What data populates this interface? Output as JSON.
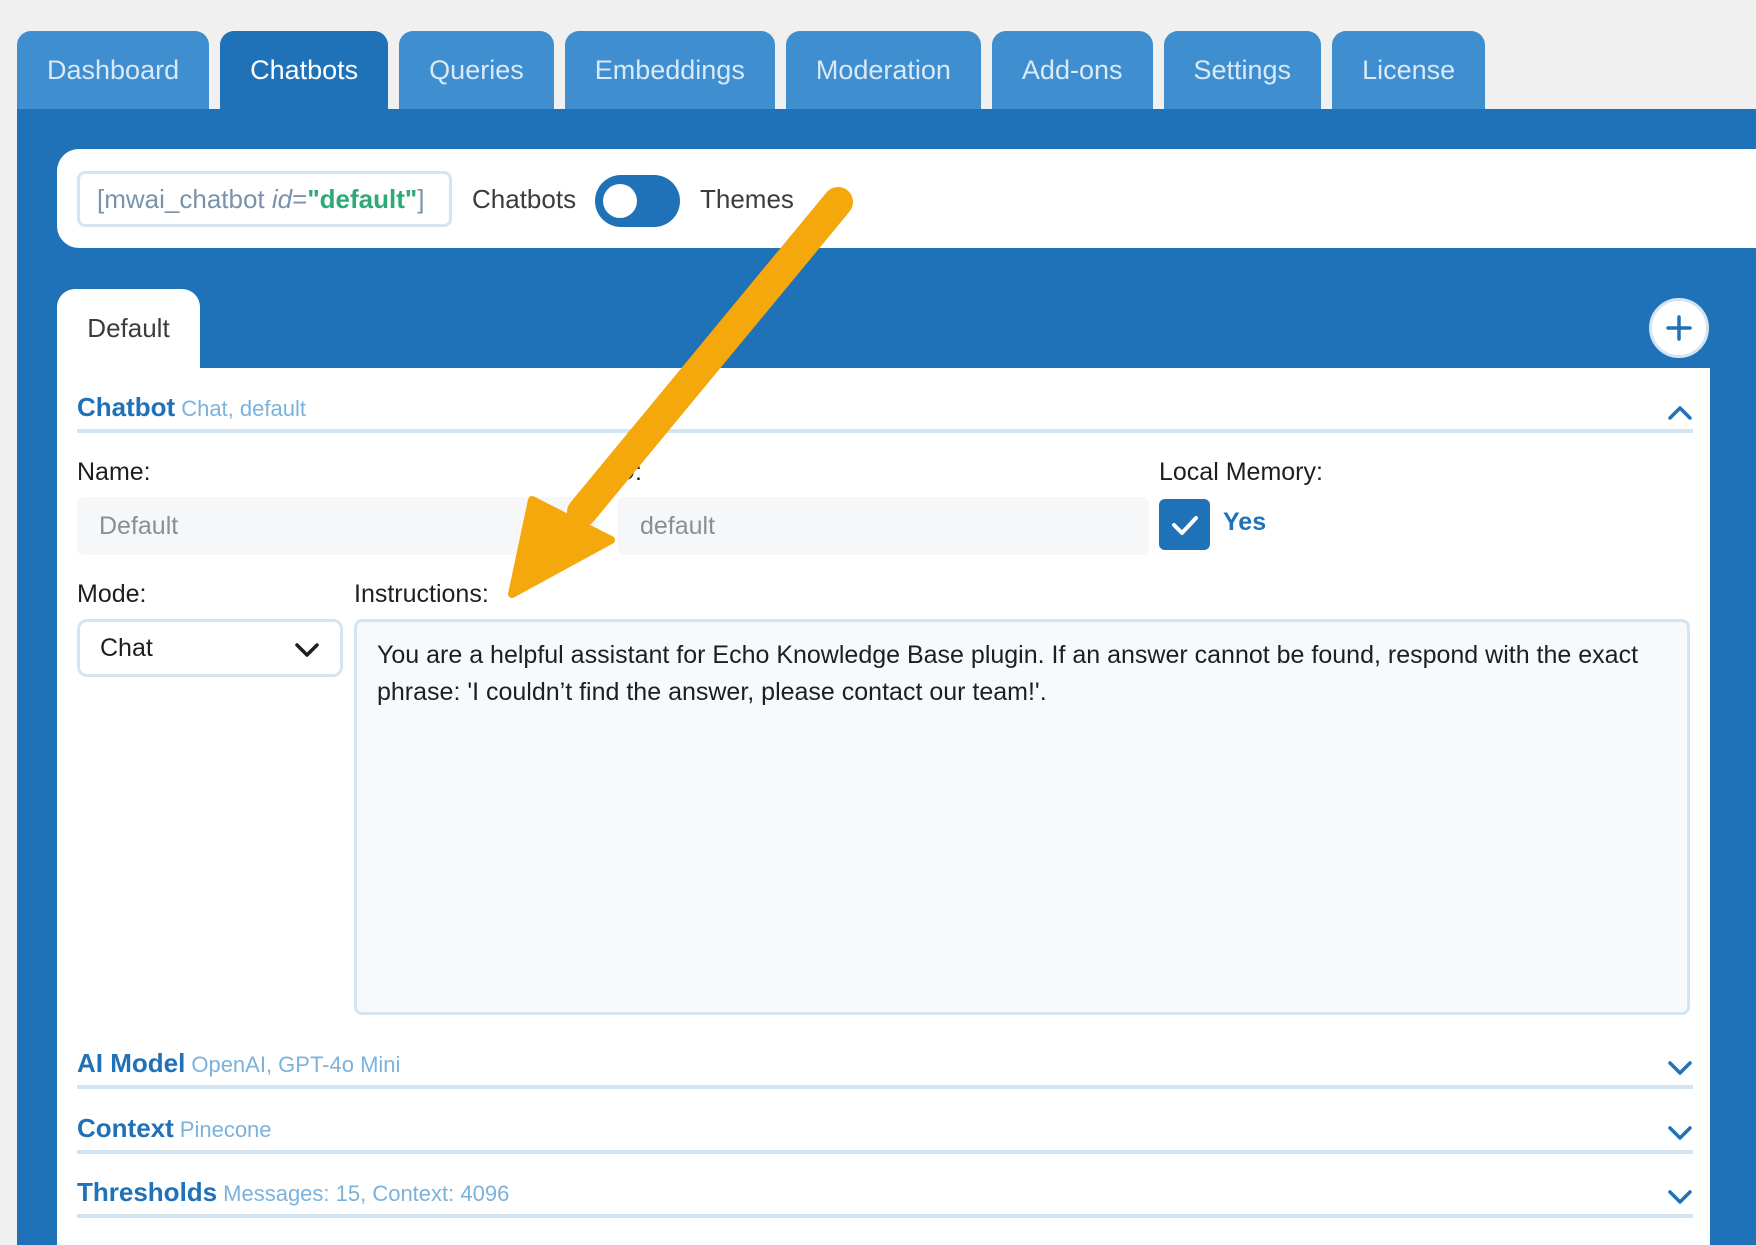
{
  "top_tabs": [
    {
      "label": "Dashboard"
    },
    {
      "label": "Chatbots"
    },
    {
      "label": "Queries"
    },
    {
      "label": "Embeddings"
    },
    {
      "label": "Moderation"
    },
    {
      "label": "Add-ons"
    },
    {
      "label": "Settings"
    },
    {
      "label": "License"
    }
  ],
  "shortcode": {
    "prefix": "[mwai_chatbot ",
    "attr": "id",
    "equals": "=",
    "value": "\"default\"",
    "suffix": "]"
  },
  "view_toggle": {
    "left_label": "Chatbots",
    "right_label": "Themes"
  },
  "chatbot_tab": {
    "label": "Default"
  },
  "add_icon": "plus-icon",
  "sections": {
    "chatbot": {
      "title": "Chatbot",
      "subtitle": "Chat, default"
    },
    "ai_model": {
      "title": "AI Model",
      "subtitle": "OpenAI, GPT-4o Mini"
    },
    "context": {
      "title": "Context",
      "subtitle": "Pinecone"
    },
    "thresholds": {
      "title": "Thresholds",
      "subtitle": "Messages: 15, Context: 4096"
    }
  },
  "form": {
    "name_label": "Name:",
    "name_value": "Default",
    "id_label": "D:",
    "id_value": "default",
    "local_memory_label": "Local Memory:",
    "local_memory_value": "Yes",
    "mode_label": "Mode:",
    "mode_value": "Chat",
    "instructions_label": "Instructions:",
    "instructions_value": "You are a helpful assistant for Echo Knowledge Base plugin. If an answer cannot be found, respond with the exact phrase: 'I couldn’t find the answer, please contact our team!'."
  },
  "colors": {
    "accent": "#1f71b8",
    "tab_inactive": "#3f8fd0",
    "annotation_arrow": "#f5a80c"
  }
}
